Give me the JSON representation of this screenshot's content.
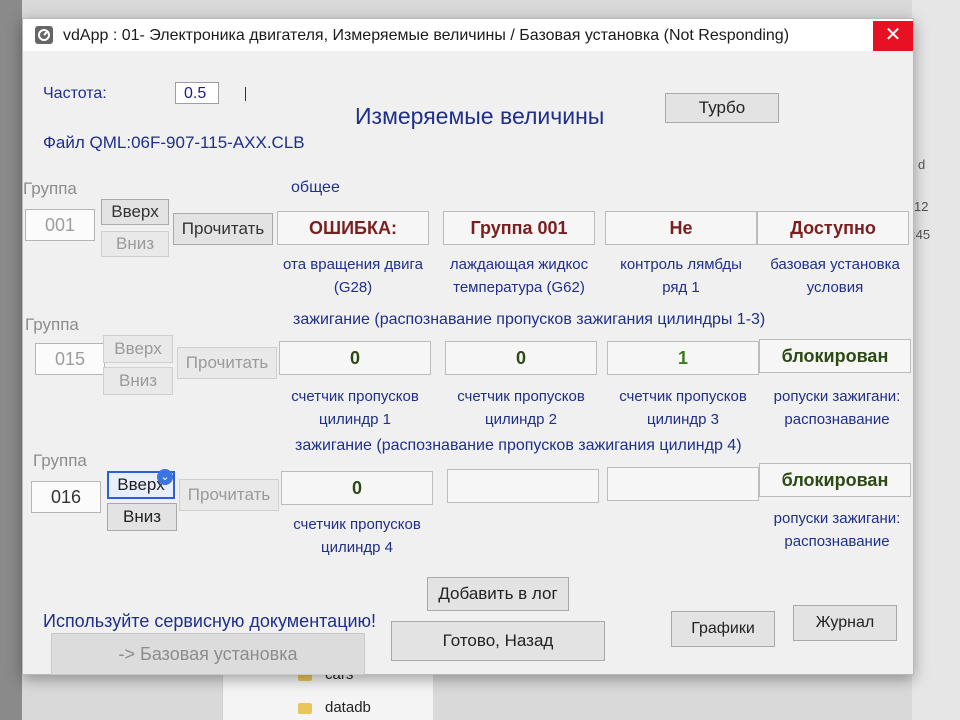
{
  "window": {
    "title": "vdApp : 01- Электроника двигателя,  Измеряемые величины / Базовая установка (Not Responding)",
    "close_symbol": "✕"
  },
  "header": {
    "frequency_label": "Частота:",
    "frequency_value": "0.5",
    "file_label": "Файл QML:06F-907-115-AXX.CLB",
    "main_title": "Измеряемые величины",
    "turbo_button": "Турбо"
  },
  "common": {
    "group_label": "Группа",
    "up_label": "Вверх",
    "down_label": "Вниз",
    "read_label": "Прочитать"
  },
  "groups": [
    {
      "number": "001",
      "section_title": "общее",
      "values": [
        "ОШИБКА:",
        "Группа 001",
        "Не",
        "Доступно"
      ],
      "captions": [
        [
          "ота вращения двига",
          "(G28)"
        ],
        [
          "лаждающая жидкос",
          "температура (G62)"
        ],
        [
          "контроль лямбды",
          "ряд 1"
        ],
        [
          "базовая установка",
          "условия"
        ]
      ]
    },
    {
      "number": "015",
      "section_title": "зажигание (распознавание пропусков зажигания цилиндры 1-3)",
      "values": [
        "0",
        "0",
        "1",
        "блокирован"
      ],
      "captions": [
        [
          "счетчик пропусков",
          "цилиндр 1"
        ],
        [
          "счетчик пропусков",
          "цилиндр 2"
        ],
        [
          "счетчик пропусков",
          "цилиндр 3"
        ],
        [
          "ропуски зажигани:",
          "распознавание"
        ]
      ]
    },
    {
      "number": "016",
      "section_title": "зажигание (распознавание пропусков зажигания цилиндр 4)",
      "values": [
        "0",
        "",
        "",
        "блокирован"
      ],
      "captions": [
        [
          "счетчик пропусков",
          "цилиндр 4"
        ],
        [
          "",
          ""
        ],
        [
          "",
          ""
        ],
        [
          "ропуски зажигани:",
          "распознавание"
        ]
      ]
    }
  ],
  "footer": {
    "notice": "Используйте сервисную документацию!",
    "add_log_button": "Добавить в лог",
    "basic_setting_button": "-> Базовая установка",
    "done_back_button": "Готово, Назад",
    "graphs_button": "Графики",
    "journal_button": "Журнал"
  },
  "background": {
    "folders": [
      "cars",
      "datadb"
    ],
    "side_texts": [
      "d",
      "12",
      ":45"
    ]
  }
}
